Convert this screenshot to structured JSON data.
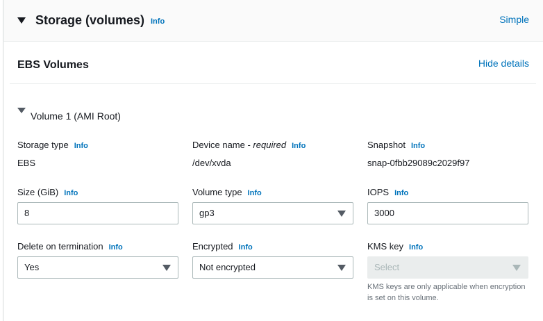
{
  "header": {
    "title": "Storage (volumes)",
    "info": "Info",
    "simple_link": "Simple"
  },
  "ebs": {
    "title": "EBS Volumes",
    "hide_details": "Hide details"
  },
  "volume": {
    "title": "Volume 1 (AMI Root)",
    "storage_type": {
      "label": "Storage type",
      "info": "Info",
      "value": "EBS"
    },
    "device_name": {
      "label": "Device name - ",
      "required": "required",
      "info": "Info",
      "value": "/dev/xvda"
    },
    "snapshot": {
      "label": "Snapshot",
      "info": "Info",
      "value": "snap-0fbb29089c2029f97"
    },
    "size": {
      "label": "Size (GiB)",
      "info": "Info",
      "value": "8"
    },
    "volume_type": {
      "label": "Volume type",
      "info": "Info",
      "value": "gp3"
    },
    "iops": {
      "label": "IOPS",
      "info": "Info",
      "value": "3000"
    },
    "delete_on_termination": {
      "label": "Delete on termination",
      "info": "Info",
      "value": "Yes"
    },
    "encrypted": {
      "label": "Encrypted",
      "info": "Info",
      "value": "Not encrypted"
    },
    "kms_key": {
      "label": "KMS key",
      "info": "Info",
      "placeholder": "Select",
      "hint": "KMS keys are only applicable when encryption is set on this volume."
    }
  }
}
